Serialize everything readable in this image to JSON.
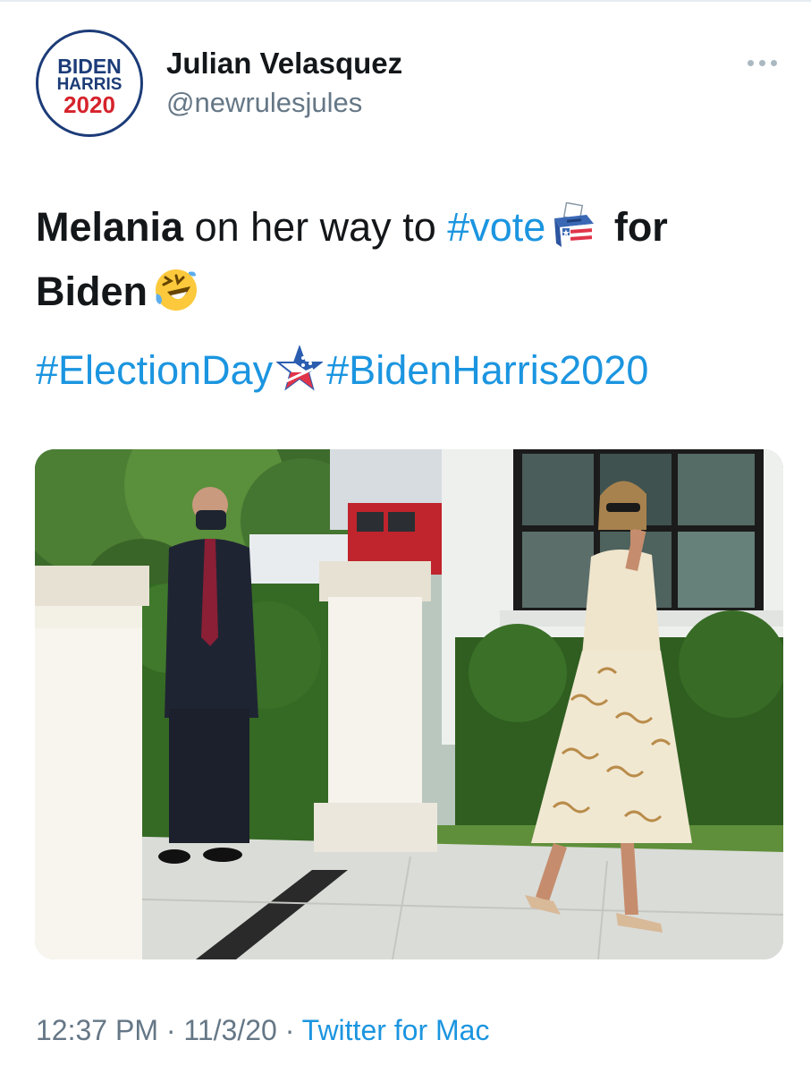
{
  "account": {
    "avatar_lines": [
      "BIDEN",
      "HARRIS",
      "2020"
    ],
    "display_name": "Julian Velasquez",
    "handle": "@newrulesjules"
  },
  "tweet": {
    "bold_name": "Melania",
    "text_part1": " on her way to ",
    "hashtag_vote": "#vote",
    "text_part2": " for",
    "text_part3": "Biden",
    "hashtag_election": "#ElectionDay",
    "hashtag_bidenharris": "#BidenHarris2020"
  },
  "icons": {
    "ballot": "ballot-box-emoji",
    "laugh": "rolling-on-floor-laughing-emoji",
    "star": "patriotic-star-emoji",
    "more": "more-options-icon"
  },
  "footer": {
    "time": "12:37 PM",
    "sep1": " · ",
    "date": "11/3/20",
    "sep2": " · ",
    "source": "Twitter for Mac"
  },
  "colors": {
    "link": "#1b95e0",
    "secondary": "#657786",
    "brand_navy": "#1c3c78",
    "brand_red": "#d6232c"
  }
}
